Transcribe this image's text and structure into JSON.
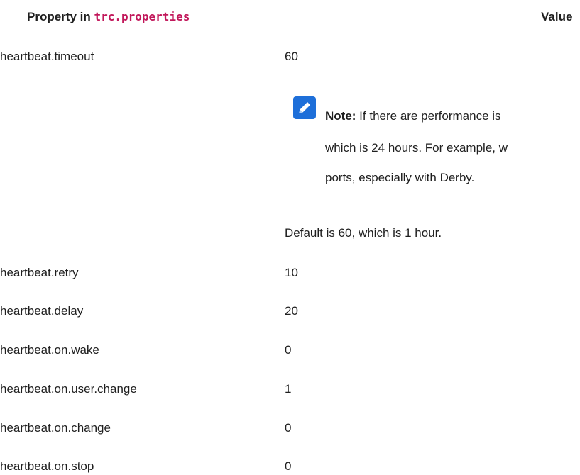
{
  "table": {
    "header": {
      "property_prefix": "Property in ",
      "property_code": "trc.properties",
      "value": "Value"
    },
    "first_row": {
      "property": "heartbeat.timeout",
      "value": "60"
    },
    "note": {
      "label": "Note:",
      "line1": " If there are performance is",
      "line2": "which is 24 hours. For example, w",
      "line3": "ports, especially with Derby."
    },
    "default_text": "Default is 60, which is 1 hour.",
    "rows": [
      {
        "property": "heartbeat.retry",
        "value": "10"
      },
      {
        "property": "heartbeat.delay",
        "value": "20"
      },
      {
        "property": "heartbeat.on.wake",
        "value": "0"
      },
      {
        "property": "heartbeat.on.user.change",
        "value": "1"
      },
      {
        "property": "heartbeat.on.change",
        "value": "0"
      },
      {
        "property": "heartbeat.on.stop",
        "value": "0"
      }
    ]
  },
  "colors": {
    "code_text": "#c2185b",
    "note_icon": "#1e6fd9"
  },
  "icons": {
    "note": "note-pencil-icon"
  }
}
